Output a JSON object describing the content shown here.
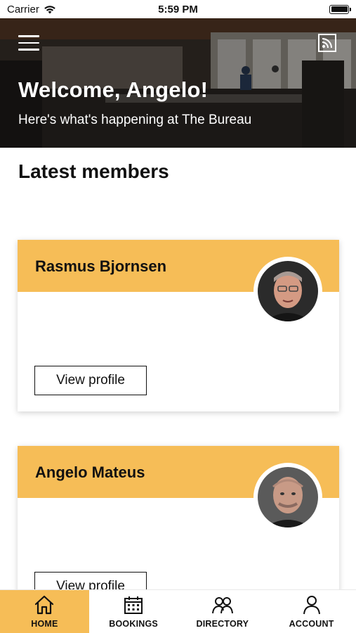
{
  "status_bar": {
    "carrier": "Carrier",
    "time": "5:59 PM"
  },
  "hero": {
    "title": "Welcome, Angelo!",
    "subtitle": "Here's what's happening at The Bureau"
  },
  "section": {
    "title": "Latest members"
  },
  "members": [
    {
      "name": "Rasmus Bjornsen",
      "button_label": "View profile"
    },
    {
      "name": "Angelo Mateus",
      "button_label": "View profile"
    }
  ],
  "tabs": [
    {
      "label": "HOME",
      "icon": "home-icon",
      "active": true
    },
    {
      "label": "BOOKINGS",
      "icon": "calendar-icon",
      "active": false
    },
    {
      "label": "DIRECTORY",
      "icon": "people-icon",
      "active": false
    },
    {
      "label": "ACCOUNT",
      "icon": "person-icon",
      "active": false
    }
  ],
  "colors": {
    "accent": "#f6bd57"
  }
}
